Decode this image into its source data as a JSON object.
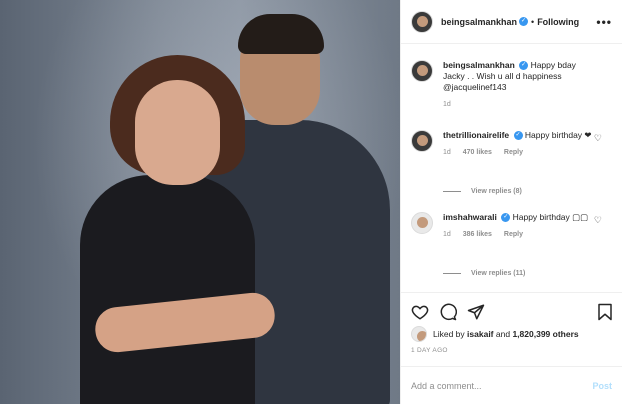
{
  "header": {
    "username": "beingsalmankhan",
    "verified_badge": "✓",
    "separator": "•",
    "follow_status": "Following",
    "more": "•••"
  },
  "caption": {
    "username": "beingsalmankhan",
    "text": "Happy bday Jacky . . Wish u all d happiness @jacquelinef143",
    "time": "1d"
  },
  "comments": [
    {
      "username": "thetrillionairelife",
      "text": "Happy birthday ❤",
      "time": "1d",
      "likes": "470 likes",
      "reply": "Reply",
      "view_replies": "View replies (8)"
    },
    {
      "username": "imshahwarali",
      "text": "Happy birthday ▢▢",
      "time": "1d",
      "likes": "386 likes",
      "reply": "Reply",
      "view_replies": "View replies (11)"
    }
  ],
  "likes": {
    "prefix": "Liked by",
    "user": "isakaif",
    "middle": "and",
    "count": "1,820,399 others"
  },
  "timestamp": "1 DAY AGO",
  "comment_box": {
    "placeholder": "Add a comment...",
    "post_label": "Post"
  },
  "icons": {
    "like": "heart-icon",
    "comment": "comment-icon",
    "share": "share-icon",
    "save": "bookmark-icon",
    "comment_like": "heart-icon"
  },
  "colors": {
    "verified": "#3897f0",
    "post_disabled": "#b2dffc",
    "muted": "#8e8e8e"
  }
}
